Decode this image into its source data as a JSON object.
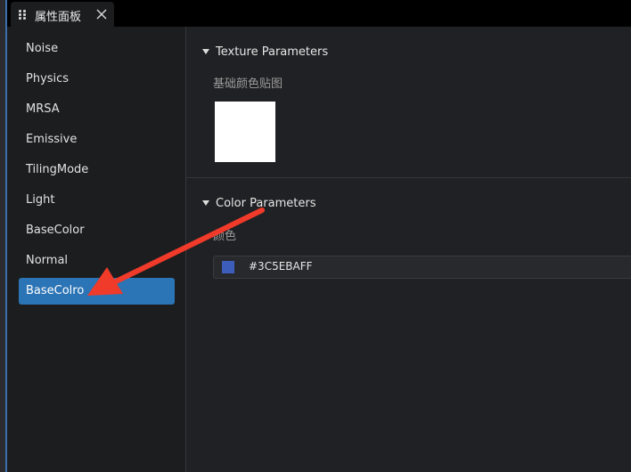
{
  "tab": {
    "title": "属性面板",
    "grip_icon": "drag-grip-icon",
    "close_icon": "close-icon"
  },
  "sidebar": {
    "items": [
      {
        "label": "Noise"
      },
      {
        "label": "Physics"
      },
      {
        "label": "MRSA"
      },
      {
        "label": "Emissive"
      },
      {
        "label": "TilingMode"
      },
      {
        "label": "Light"
      },
      {
        "label": "BaseColor"
      },
      {
        "label": "Normal"
      },
      {
        "label": "BaseColro",
        "selected": true
      }
    ]
  },
  "sections": {
    "texture": {
      "title": "Texture Parameters",
      "field_label": "基础颜色贴图",
      "thumb_color": "#FFFFFF"
    },
    "color": {
      "title": "Color Parameters",
      "field_label": "颜色",
      "hex_value": "#3C5EBAFF",
      "swatch_color": "#3C5EBA"
    }
  },
  "colors": {
    "accent": "#2B74B5",
    "annotation_arrow": "#F03A2A"
  }
}
